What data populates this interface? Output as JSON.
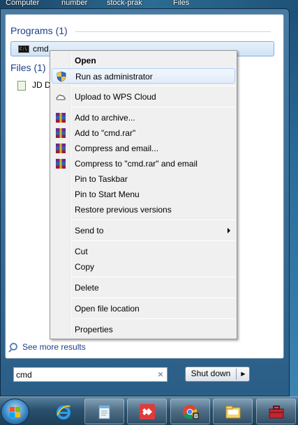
{
  "desktop": {
    "labels": [
      "Computer",
      "number",
      "stock-prak",
      "Files"
    ]
  },
  "start_menu": {
    "programs_header": "Programs (1)",
    "program_item": "cmd",
    "files_header": "Files (1)",
    "file_item": "JD Da",
    "see_more": "See more results",
    "search_value": "cmd",
    "clear_label": "×",
    "shutdown_label": "Shut down",
    "shutdown_arrow": "▶"
  },
  "context_menu": {
    "items": [
      {
        "label": "Open",
        "icon": "none"
      },
      {
        "label": "Run as administrator",
        "icon": "uac-shield-icon"
      },
      {
        "label": "Upload to WPS Cloud",
        "icon": "cloud-icon"
      },
      {
        "label": "Add to archive...",
        "icon": "winrar-icon"
      },
      {
        "label": "Add to \"cmd.rar\"",
        "icon": "winrar-icon"
      },
      {
        "label": "Compress and email...",
        "icon": "winrar-icon"
      },
      {
        "label": "Compress to \"cmd.rar\" and email",
        "icon": "winrar-icon"
      },
      {
        "label": "Pin to Taskbar",
        "icon": "none"
      },
      {
        "label": "Pin to Start Menu",
        "icon": "none"
      },
      {
        "label": "Restore previous versions",
        "icon": "none"
      },
      {
        "label": "Send to",
        "icon": "none"
      },
      {
        "label": "Cut",
        "icon": "none"
      },
      {
        "label": "Copy",
        "icon": "none"
      },
      {
        "label": "Delete",
        "icon": "none"
      },
      {
        "label": "Open file location",
        "icon": "none"
      },
      {
        "label": "Properties",
        "icon": "none"
      }
    ]
  },
  "taskbar": {
    "items": [
      "start-orb",
      "internet-explorer-icon",
      "notepad-icon",
      "anydesk-icon",
      "chrome-icon",
      "file-explorer-icon",
      "toolbox-icon"
    ]
  },
  "colors": {
    "accent_blue": "#1e3f8a",
    "hover_border": "#aecff7",
    "winrar_red": "#9e1c2c",
    "anydesk_red": "#e03b3b"
  }
}
